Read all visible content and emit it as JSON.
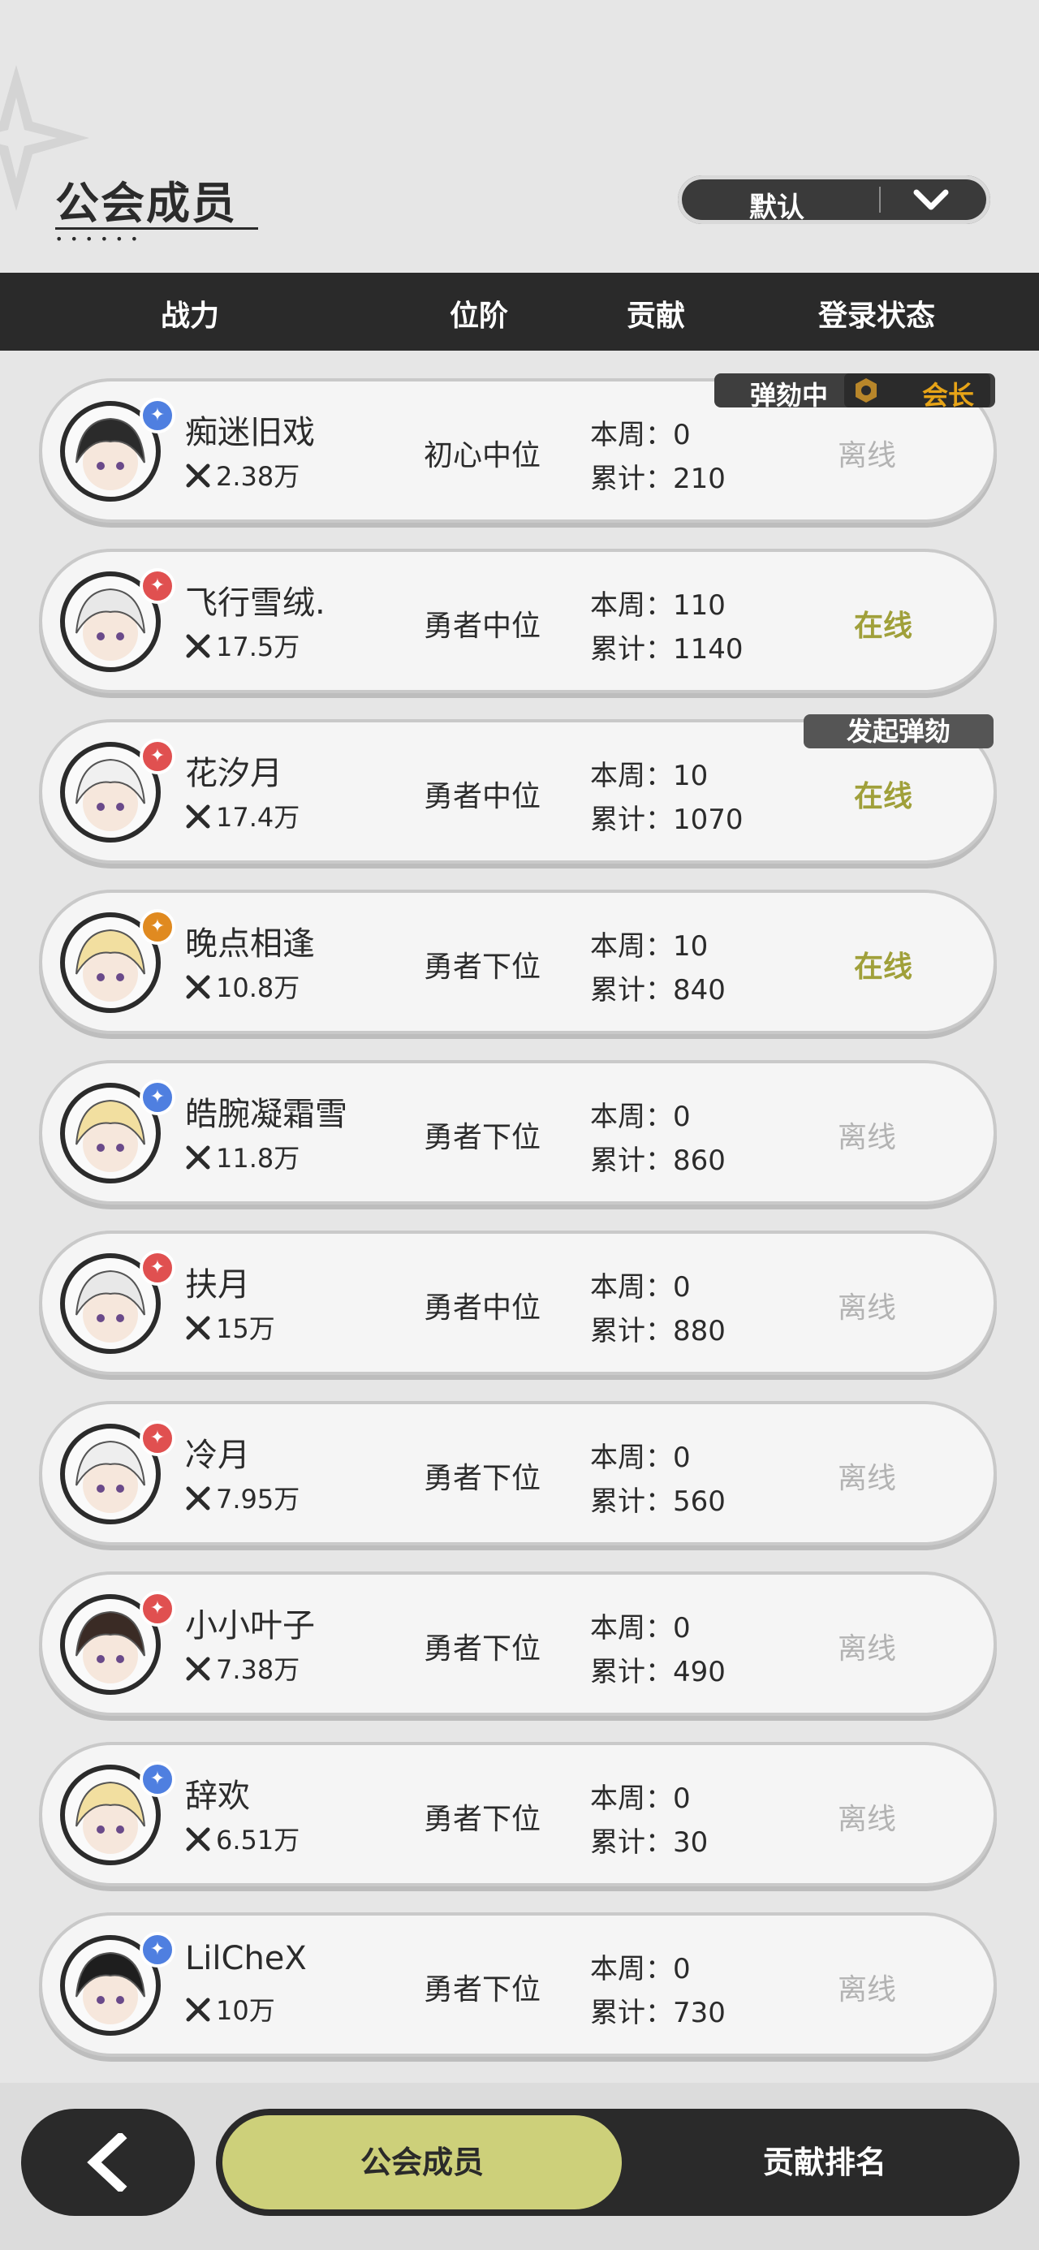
{
  "header": {
    "title": "公会成员",
    "sort_label": "默认"
  },
  "columns": {
    "power": "战力",
    "position": "位阶",
    "contribution": "贡献",
    "login": "登录状态"
  },
  "badges": {
    "impeaching": "弹劾中",
    "leader": "会长",
    "start_impeach": "发起弹劾"
  },
  "members": [
    {
      "name": "痴迷旧戏",
      "power": "2.38万",
      "position": "初心中位",
      "week": "本周：0",
      "total": "累计：210",
      "status": "离线",
      "online": false,
      "badge_color": "#4f7fe0",
      "badge_icon": "feather-icon"
    },
    {
      "name": "飞行雪绒.",
      "power": "17.5万",
      "position": "勇者中位",
      "week": "本周：110",
      "total": "累计：1140",
      "status": "在线",
      "online": true,
      "badge_color": "#e05050",
      "badge_icon": "shield-icon"
    },
    {
      "name": "花汐月",
      "power": "17.4万",
      "position": "勇者中位",
      "week": "本周：10",
      "total": "累计：1070",
      "status": "在线",
      "online": true,
      "badge_color": "#e05050",
      "badge_icon": "shield-icon"
    },
    {
      "name": "晚点相逢",
      "power": "10.8万",
      "position": "勇者下位",
      "week": "本周：10",
      "total": "累计：840",
      "status": "在线",
      "online": true,
      "badge_color": "#e08a20",
      "badge_icon": "crown-icon"
    },
    {
      "name": "皓腕凝霜雪",
      "power": "11.8万",
      "position": "勇者下位",
      "week": "本周：0",
      "total": "累计：860",
      "status": "离线",
      "online": false,
      "badge_color": "#4f7fe0",
      "badge_icon": "flower-icon"
    },
    {
      "name": "扶月",
      "power": "15万",
      "position": "勇者中位",
      "week": "本周：0",
      "total": "累计：880",
      "status": "离线",
      "online": false,
      "badge_color": "#e05050",
      "badge_icon": "shield-icon"
    },
    {
      "name": "冷月",
      "power": "7.95万",
      "position": "勇者下位",
      "week": "本周：0",
      "total": "累计：560",
      "status": "离线",
      "online": false,
      "badge_color": "#e05050",
      "badge_icon": "sword-icon"
    },
    {
      "name": "小小叶子",
      "power": "7.38万",
      "position": "勇者下位",
      "week": "本周：0",
      "total": "累计：490",
      "status": "离线",
      "online": false,
      "badge_color": "#e05050",
      "badge_icon": "sword-icon"
    },
    {
      "name": "辞欢",
      "power": "6.51万",
      "position": "勇者下位",
      "week": "本周：0",
      "total": "累计：30",
      "status": "离线",
      "online": false,
      "badge_color": "#4f7fe0",
      "badge_icon": "feather-icon"
    },
    {
      "name": "LilCheX",
      "power": "10万",
      "position": "勇者下位",
      "week": "本周：0",
      "total": "累计：730",
      "status": "离线",
      "online": false,
      "badge_color": "#4f7fe0",
      "badge_icon": "feather-icon"
    }
  ],
  "tabs": {
    "members": "公会成员",
    "ranking": "贡献排名"
  }
}
